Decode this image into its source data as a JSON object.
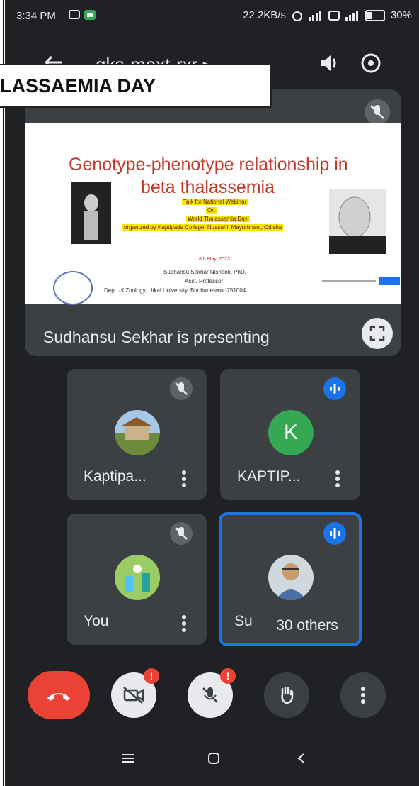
{
  "status_bar": {
    "time": "3:34 PM",
    "net_speed": "22.2KB/s",
    "battery": "30%"
  },
  "top_bar": {
    "meeting_code": "gks-mext-rxr ▸"
  },
  "banner": {
    "text": "LASSAEMIA DAY"
  },
  "presentation": {
    "slide": {
      "title_line1": "Genotype-phenotype relationship in",
      "title_line2": "beta thalassemia",
      "talk_line1": "Talk for National Webinar",
      "talk_line2": "On",
      "talk_line3": "World Thalassemia Day,",
      "talk_line4": "organized by Kaptipada College, Nuasahi, Mayurbhanj, Odisha",
      "date": "8th May, 2023",
      "author": "Sudhansu Sekhar Nishank, PhD.",
      "position": "Asst. Professor",
      "dept": "Dept. of Zoology, Utkal University, Bhubaneswar-751004"
    },
    "presenting_label": "Sudhansu Sekhar is presenting"
  },
  "participants": [
    {
      "name": "Kaptipa...",
      "muted": true
    },
    {
      "name": "KAPTIP...",
      "avatar_letter": "K",
      "speaking": true
    },
    {
      "name": "You",
      "muted": true
    },
    {
      "name": "Su",
      "speaking": true,
      "active": true
    }
  ],
  "others_chip": "30 others",
  "controls": {
    "camera_alert": "!",
    "mic_alert": "!"
  },
  "colors": {
    "background": "#202124",
    "tile": "#3c4043",
    "end_call": "#ea4335",
    "accent_blue": "#1a73e8",
    "avatar_green": "#34a853"
  },
  "icons": [
    "back-arrow-icon",
    "speaker-icon",
    "switch-camera-icon",
    "mic-off-icon",
    "fullscreen-icon",
    "more-vert-icon",
    "speaking-icon",
    "end-call-icon",
    "camera-off-icon",
    "raise-hand-icon",
    "menu-icon",
    "home-icon",
    "back-icon"
  ]
}
